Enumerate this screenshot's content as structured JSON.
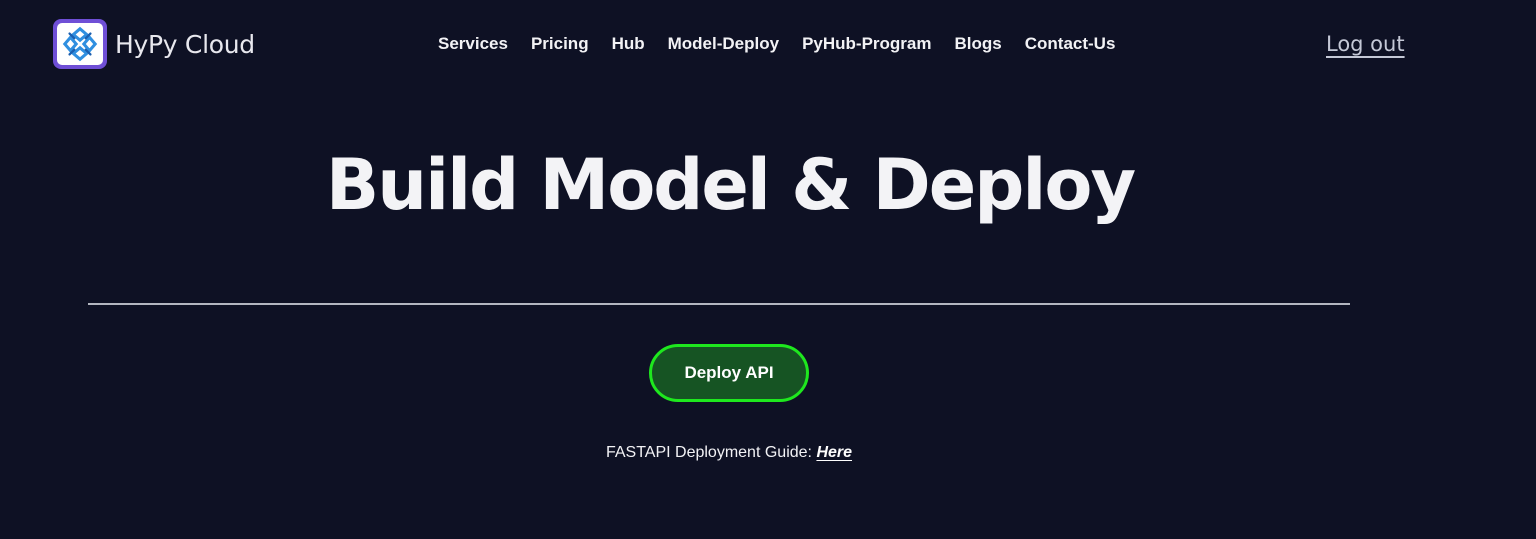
{
  "header": {
    "brand": "HyPy Cloud",
    "logo_icon": "hypy-cloud-logo-icon",
    "nav": [
      {
        "label": "Services"
      },
      {
        "label": "Pricing"
      },
      {
        "label": "Hub"
      },
      {
        "label": "Model-Deploy"
      },
      {
        "label": "PyHub-Program"
      },
      {
        "label": "Blogs"
      },
      {
        "label": "Contact-Us"
      }
    ],
    "logout_label": "Log out"
  },
  "hero": {
    "title": "Build Model & Deploy",
    "deploy_button": "Deploy API",
    "guide_text": "FASTAPI Deployment Guide:",
    "guide_link": "Here"
  },
  "colors": {
    "background": "#0e1124",
    "button_border": "#1ee81e",
    "button_fill": "#165423",
    "logo_frame": "#6f4fd6",
    "logo_accent": "#2f8fe0"
  }
}
